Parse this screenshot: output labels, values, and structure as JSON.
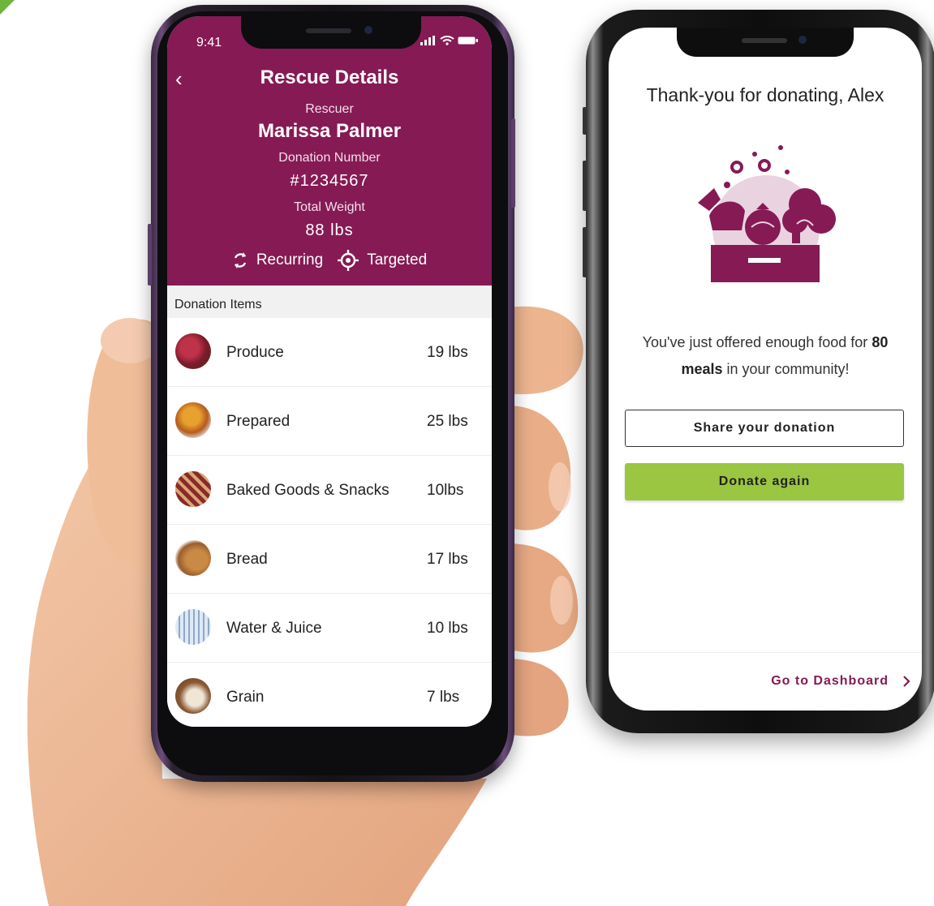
{
  "left_phone": {
    "status": {
      "time": "9:41"
    },
    "header": {
      "title": "Rescue Details",
      "rescuer_label": "Rescuer",
      "rescuer_name": "Marissa Palmer",
      "donation_number_label": "Donation Number",
      "donation_number": "#1234567",
      "total_weight_label": "Total Weight",
      "total_weight": "88 lbs",
      "tags": [
        "Recurring",
        "Targeted"
      ]
    },
    "section_title": "Donation Items",
    "items": [
      {
        "name": "Produce",
        "weight": "19 lbs",
        "icon": "produce-thumb"
      },
      {
        "name": "Prepared",
        "weight": "25 lbs",
        "icon": "prepared-thumb"
      },
      {
        "name": "Baked Goods & Snacks",
        "weight": "10lbs",
        "icon": "baked-goods-thumb"
      },
      {
        "name": "Bread",
        "weight": "17 lbs",
        "icon": "bread-thumb"
      },
      {
        "name": "Water & Juice",
        "weight": "10 lbs",
        "icon": "water-juice-thumb"
      },
      {
        "name": "Grain",
        "weight": "7 lbs",
        "icon": "grain-thumb"
      }
    ],
    "colors": {
      "header": "#861a55",
      "text_on_header": "#ffffff"
    }
  },
  "right_phone": {
    "thanks_title": "Thank-you for donating, Alex",
    "message_pre": "You've just offered enough food for",
    "message_bold_1": "80",
    "message_bold_2": "meals",
    "message_post": "in your community!",
    "share_button": "Share your donation",
    "donate_button": "Donate again",
    "dashboard_link": "Go to Dashboard",
    "colors": {
      "accent": "#861a55",
      "donate_button": "#9bc641"
    }
  }
}
